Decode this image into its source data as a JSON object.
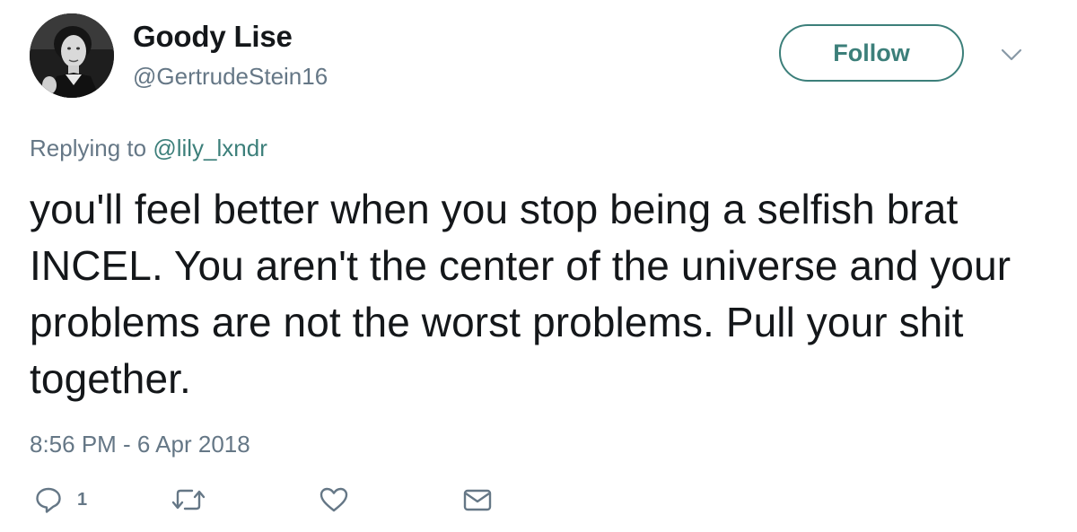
{
  "user": {
    "display_name": "Goody Lise",
    "handle": "@GertrudeStein16"
  },
  "follow_button": {
    "label": "Follow"
  },
  "reply_context": {
    "prefix": "Replying to ",
    "mention": "@lily_lxndr"
  },
  "tweet": {
    "text": "you'll feel better when you stop being a selfish brat INCEL. You aren't the center of the universe and your problems are not the worst problems. Pull your shit together.",
    "timestamp": "8:56 PM - 6 Apr 2018"
  },
  "actions": {
    "reply_count": "1",
    "icons": [
      "reply-icon",
      "retweet-icon",
      "like-icon",
      "direct-message-icon"
    ]
  },
  "colors": {
    "accent": "#3c7f7a",
    "secondary_text": "#657786",
    "primary_text": "#14171a"
  }
}
